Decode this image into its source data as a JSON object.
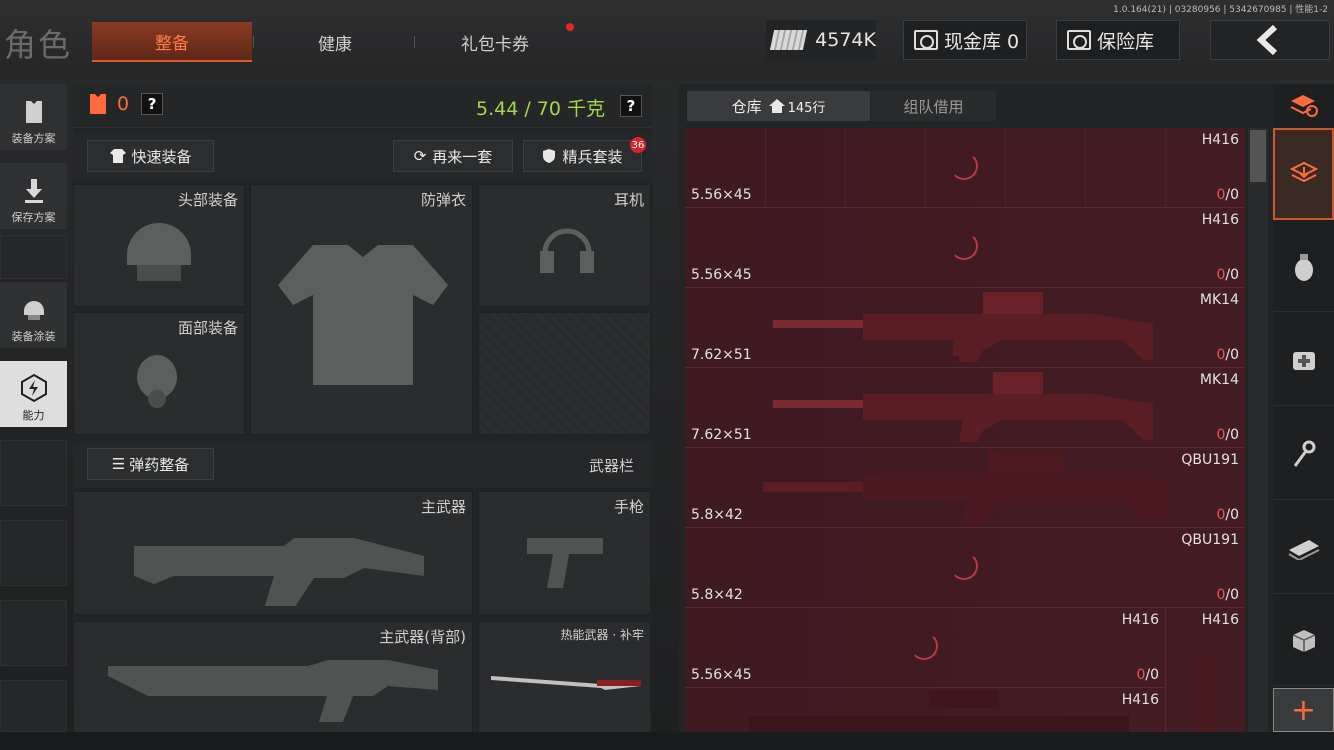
{
  "version": "1.0.164(21) | 03280956 | 5342670985 | 性能1-2",
  "header": {
    "title": "角色",
    "tabs": [
      "整备",
      "健康",
      "礼包卡券"
    ],
    "cash": "4574K",
    "vault_label": "现金库 0",
    "safe_label": "保险库"
  },
  "sidebar": {
    "items": [
      {
        "label": "装备方案",
        "icon": "vest-icon"
      },
      {
        "label": "保存方案",
        "icon": "download-icon"
      },
      {
        "label": "装备涂装",
        "icon": "helmet-icon"
      },
      {
        "label": "能力",
        "icon": "lightning-icon"
      }
    ]
  },
  "loadout": {
    "vest_count": "0",
    "help": "?",
    "weight": "5.44 / 70 千克",
    "quick_equip": "快速装备",
    "retry_set": "再来一套",
    "elite_set": "精兵套装",
    "elite_badge": "36",
    "slots": {
      "head": "头部装备",
      "armor": "防弹衣",
      "headset": "耳机",
      "face": "面部装备"
    },
    "ammo_button": "弹药整备",
    "weapon_bar": "武器栏",
    "primary": "主武器",
    "pistol": "手枪",
    "primary_back": "主武器(背部)",
    "melee": "热能武器 · 补牢"
  },
  "warehouse": {
    "tab_storage": "仓库",
    "storage_rows": "145行",
    "tab_team": "组队借用",
    "rows": [
      {
        "name": "H416",
        "caliber": "5.56×45",
        "count": "0/0",
        "loading": true
      },
      {
        "name": "H416",
        "caliber": "5.56×45",
        "count": "0/0",
        "loading": true
      },
      {
        "name": "MK14",
        "caliber": "7.62×51",
        "count": "0/0",
        "loading": false
      },
      {
        "name": "MK14",
        "caliber": "7.62×51",
        "count": "0/0",
        "loading": false
      },
      {
        "name": "QBU191",
        "caliber": "5.8×42",
        "count": "0/0",
        "loading": false
      },
      {
        "name": "QBU191",
        "caliber": "5.8×42",
        "count": "0/0",
        "loading": true
      },
      {
        "name": "H416",
        "caliber": "5.56×45",
        "count": "0/0",
        "loading": true,
        "side_name": "H416"
      },
      {
        "name": "H416",
        "caliber": "",
        "count": "",
        "loading": false
      }
    ]
  },
  "rail": {
    "icons": [
      "layers-refresh-icon",
      "box-down-icon",
      "grenade-icon",
      "medkit-icon",
      "key-icon",
      "cash-icon",
      "package-icon"
    ],
    "add": "+"
  },
  "colors": {
    "accent": "#e0592a",
    "weight": "#a6d64a",
    "count": "#e05a55",
    "grid": "#3d1a20"
  }
}
